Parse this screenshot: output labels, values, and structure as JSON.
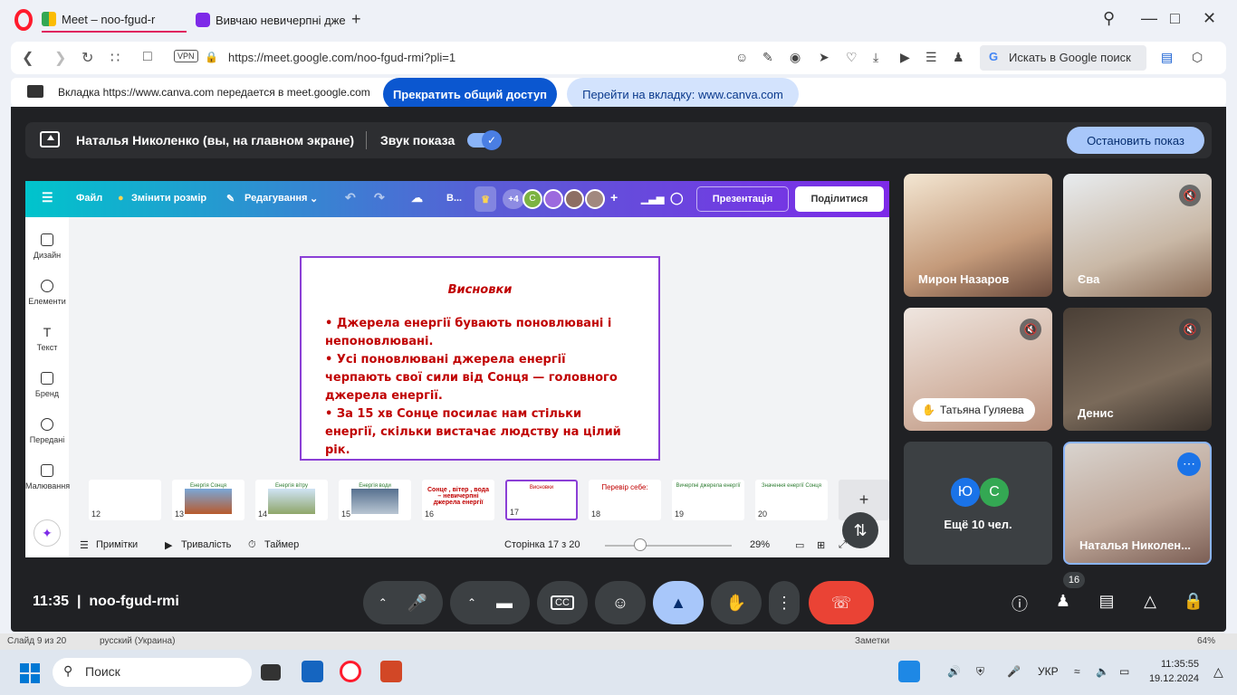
{
  "browser": {
    "tabs": [
      {
        "label": "Meet – noo-fgud-r"
      },
      {
        "label": "Вивчаю невичерпні дже"
      }
    ],
    "url": "https://meet.google.com/noo-fgud-rmi?pli=1",
    "vpn_label": "VPN",
    "google_search_label": "Искать в Google поиск"
  },
  "share_notice": {
    "text": "Вкладка https://www.canva.com передается в meet.google.com",
    "stop_label": "Прекратить общий доступ",
    "goto_label": "Перейти на вкладку: www.canva.com"
  },
  "presenting": {
    "presenter": "Наталья Николенко (вы, на главном экране)",
    "sound_label": "Звук показа",
    "sound_on": true,
    "stop_label": "Остановить показ"
  },
  "canva": {
    "menu": {
      "file": "Файл",
      "resize": "Змінити розмір",
      "edit": "Редагування",
      "plus_count": "+4",
      "avatar_letter": "С",
      "present": "Презентація",
      "share": "Поділитися",
      "trunc": "В..."
    },
    "sidebar": [
      {
        "label": "Дизайн"
      },
      {
        "label": "Елементи"
      },
      {
        "label": "Текст"
      },
      {
        "label": "Бренд"
      },
      {
        "label": "Передані"
      },
      {
        "label": "Малювання"
      }
    ],
    "slide": {
      "title": "Висновки",
      "bullets": [
        "• Джерела енергії бувають поновлювані і непоновлювані.",
        "• Усі поновлювані джерела енергії черпають свої сили від Сонця — головного джерела енергії.",
        "• За 15 хв Сонце посилає нам стільки енергії, скільки вистачає людству на цілий рік."
      ]
    },
    "thumbnails": [
      {
        "num": "12",
        "title": ""
      },
      {
        "num": "13",
        "title": "Енергія Сонця"
      },
      {
        "num": "14",
        "title": "Енергія вітру"
      },
      {
        "num": "15",
        "title": "Енергія води"
      },
      {
        "num": "16",
        "title": "Сонце , вітер , вода – невичерпні джерела енергії"
      },
      {
        "num": "17",
        "title": "Висновки"
      },
      {
        "num": "18",
        "title": "Перевір себе:"
      },
      {
        "num": "19",
        "title": "Вичерпні джерела енергії"
      },
      {
        "num": "20",
        "title": "Значення енергії Сонця"
      }
    ],
    "bottom": {
      "notes": "Примітки",
      "duration": "Тривалість",
      "timer": "Таймер",
      "page": "Сторінка 17 з 20",
      "zoom": "29%",
      "zoom_fraction": 0.29
    }
  },
  "participants": [
    {
      "name": "Мирон Назаров",
      "muted": false
    },
    {
      "name": "Єва",
      "muted": true
    },
    {
      "name": "Татьяна Гуляева",
      "muted": true
    },
    {
      "name": "Денис",
      "muted": true
    },
    {
      "name": "Наталья Николен...",
      "muted": false
    }
  ],
  "more_participants": {
    "label": "Ещё 10 чел.",
    "avatars": [
      "Ю",
      "С"
    ]
  },
  "meeting": {
    "time": "11:35",
    "code": "noo-fgud-rmi",
    "people_count": "16"
  },
  "behind_window": {
    "slide_info": "Слайд 9 из 20",
    "language": "русский (Украина)",
    "notes": "Заметки",
    "zoom": "64%"
  },
  "taskbar": {
    "search_placeholder": "Поиск",
    "lang": "УКР",
    "time": "11:35:55",
    "date": "19.12.2024"
  },
  "colors": {
    "meet_bg": "#202124",
    "accent_blue": "#0b57d0",
    "end_call_red": "#ea4335",
    "slide_red": "#c00000",
    "canva_purple": "#7d2ae8"
  }
}
